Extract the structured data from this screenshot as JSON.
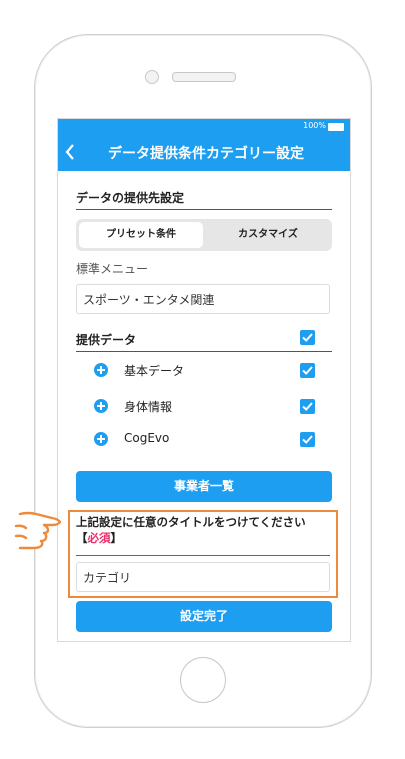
{
  "status_bar": {
    "battery": "100%"
  },
  "header": {
    "title": "データ提供条件カテゴリー設定"
  },
  "destination": {
    "heading": "データの提供先設定",
    "segments": [
      "プリセット条件",
      "カスタマイズ"
    ],
    "menu_label": "標準メニュー",
    "menu_value": "スポーツ・エンタメ関連"
  },
  "provided_data": {
    "heading": "提供データ",
    "items": [
      {
        "label": "基本データ"
      },
      {
        "label": "身体情報"
      },
      {
        "label": "CogEvo"
      }
    ]
  },
  "provider_list_button": "事業者一覧",
  "title_section": {
    "prompt": "上記設定に任意のタイトルをつけてください",
    "required_open": "【",
    "required_text": "必須",
    "required_close": "】",
    "value": "カテゴリ"
  },
  "complete_button": "設定完了",
  "colors": {
    "accent": "#1e9ef0",
    "highlight": "#ee8a3b",
    "required": "#e8316b"
  }
}
